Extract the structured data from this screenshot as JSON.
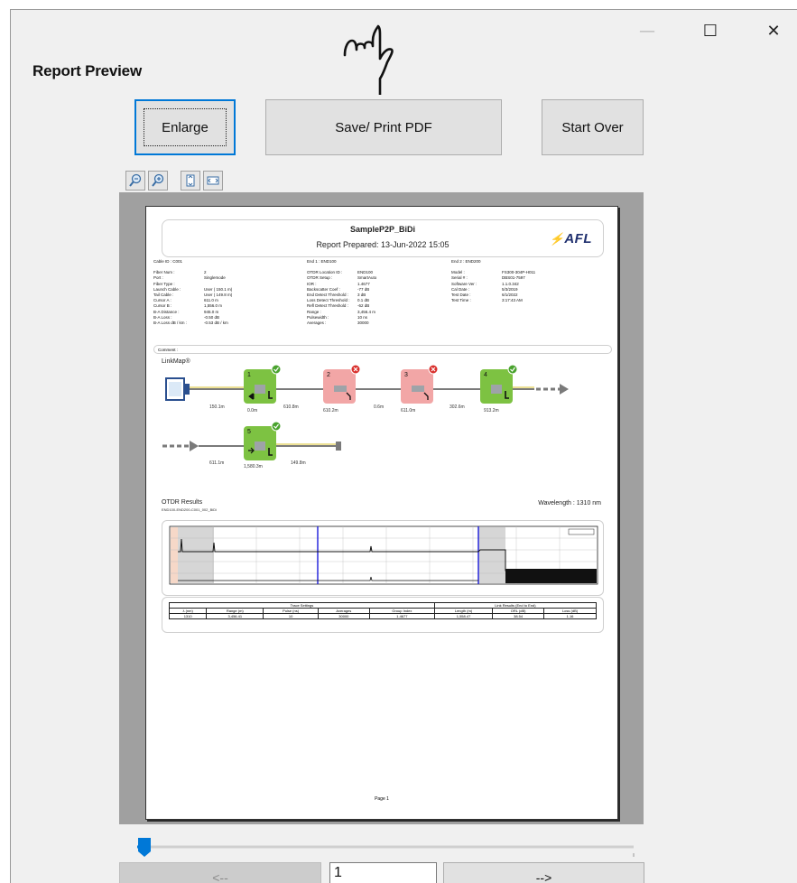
{
  "window": {
    "title": "Report Preview",
    "controls": {
      "minimize_glyph": "—",
      "maximize_glyph": "☐",
      "close_glyph": "✕"
    }
  },
  "toolbar": {
    "enlarge_label": "Enlarge",
    "save_label": "Save/ Print PDF",
    "start_over_label": "Start Over",
    "zoom_icons": [
      "zoom-out-icon",
      "zoom-in-icon",
      "fit-height-icon",
      "fit-width-icon"
    ]
  },
  "report": {
    "name": "SampleP2P_BiDi",
    "prepared": "Report Prepared:  13-Jun-2022   15:05",
    "logo": "AFL",
    "cable_id": "Cable ID :   C001",
    "end1": "End 1 :   END100",
    "end2": "End 2 :   END200",
    "col1": [
      [
        "Fiber Num :",
        "2"
      ],
      [
        "Port :",
        "Singlemode"
      ],
      [
        "Fiber Type :",
        ""
      ],
      [
        "Launch Cable :",
        "User ( 150.1 m)"
      ],
      [
        "Tail Cable :",
        "User ( 149.8 m)"
      ],
      [
        "Cursor A :",
        "611.0  m"
      ],
      [
        "Cursor B :",
        "1,556.0  m"
      ],
      [
        "B-A Distance :",
        "945.0  m"
      ],
      [
        "B-A Loss :",
        "-0.50  dB"
      ],
      [
        "B-A Loss   dB / km :",
        "-0.53 dB / km"
      ]
    ],
    "col2": [
      [
        "OTDR Location ID :",
        "END100"
      ],
      [
        "OTDR Setup :",
        "SmartAuto"
      ],
      [
        "IOR :",
        "1.4677"
      ],
      [
        "Backscatter Coef :",
        "-77  dB"
      ],
      [
        "End Detect Threshold :",
        "3  dB"
      ],
      [
        "Loss Detect Threshold :",
        "0.1  dB"
      ],
      [
        "Refl Detect Threshold :",
        "-62  dB"
      ],
      [
        "Range :",
        "3,456.4  m"
      ],
      [
        "Pulsewidth :",
        "10  ns"
      ],
      [
        "Averages :",
        "30000"
      ]
    ],
    "col3": [
      [
        "Model :",
        "FS300-304P-H011"
      ],
      [
        "Serial # :",
        "DBS01-7597"
      ],
      [
        "Software Ver :",
        "1.1.0.342"
      ],
      [
        "Cal Date :",
        "5/3/2019"
      ],
      [
        "Test Date :",
        "6/1/2022"
      ],
      [
        "Test Time :",
        "3:17:43 AM"
      ]
    ],
    "comment_label": "Comment :",
    "linkmap_label": "LinkMap®",
    "events": [
      {
        "num": "1",
        "status": "pass"
      },
      {
        "num": "2",
        "status": "fail"
      },
      {
        "num": "3",
        "status": "fail"
      },
      {
        "num": "4",
        "status": "pass"
      },
      {
        "num": "5",
        "status": "pass"
      }
    ],
    "distances_row1": [
      "150.1m",
      "0.0m",
      "610.8m",
      "610.2m",
      "0.6m",
      "611.0m",
      "302.6m",
      "913.2m"
    ],
    "distances_row2": [
      "611.1m",
      "1,580.3m",
      "149.8m"
    ],
    "otdr_label": "OTDR Results",
    "trace_file": "END100-END200-C001_002_BiDi",
    "wavelength": "Wavelength :    1310 nm",
    "table_header_trace": "Trace Settings",
    "table_header_link": "Link Results (End to End)",
    "table_cols": [
      "λ (nm)",
      "Range (m)",
      "Pulse (ns)",
      "Averages",
      "Group Index",
      "Length (m)",
      "ORL (dB)",
      "Loss (dB)"
    ],
    "table_values": [
      "1310",
      "3,456.41",
      "10",
      "30000",
      "1.4677",
      "1,558.47",
      "38.54",
      "1.16"
    ],
    "page_footer": "Page 1"
  },
  "nav": {
    "prev_label": "<--",
    "page_value": "1",
    "next_label": "-->"
  }
}
